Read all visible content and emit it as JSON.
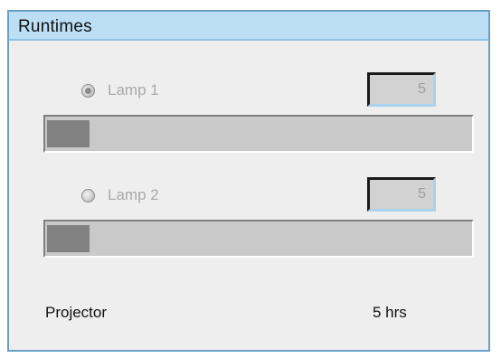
{
  "panel": {
    "title": "Runtimes"
  },
  "lamps": [
    {
      "label": "Lamp 1",
      "selected": true,
      "value": "5",
      "progress_fraction": 0.1
    },
    {
      "label": "Lamp 2",
      "selected": false,
      "value": "5",
      "progress_fraction": 0.1
    }
  ],
  "projector": {
    "label": "Projector",
    "value": "5 hrs"
  },
  "colors": {
    "title_bg": "#bcdff5",
    "panel_border": "#6aa0c7",
    "panel_bg": "#eeeeee",
    "bar_bg": "#c9c9c9",
    "bar_fill": "#818181",
    "disabled_text": "#a9a9a9"
  }
}
